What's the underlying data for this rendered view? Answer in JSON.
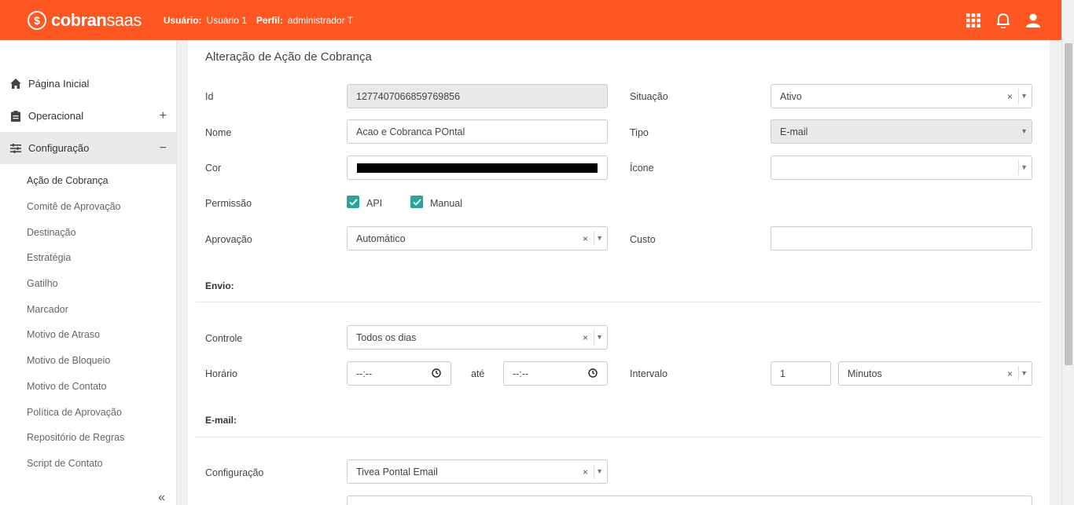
{
  "header": {
    "logo_symbol": "$",
    "logo_bold": "cobran",
    "logo_light": "saas",
    "user_label": "Usuário:",
    "user_value": "Usuário 1",
    "profile_label": "Perfil:",
    "profile_value": "administrador T",
    "accent_color": "#ff5722"
  },
  "sidebar": {
    "items": [
      {
        "label": "Página Inicial",
        "icon": "home-icon"
      },
      {
        "label": "Operacional",
        "icon": "clipboard-icon",
        "toggle": "+"
      },
      {
        "label": "Configuração",
        "icon": "sliders-icon",
        "toggle": "−"
      }
    ],
    "subitems": [
      "Ação de Cobrança",
      "Comitê de Aprovação",
      "Destinação",
      "Estratégia",
      "Gatilho",
      "Marcador",
      "Motivo de Atraso",
      "Motivo de Bloqueio",
      "Motivo de Contato",
      "Política de Aprovação",
      "Repositório de Regras",
      "Script de Contato"
    ],
    "collapse_label": "«"
  },
  "form": {
    "title": "Alteração de Ação de Cobrança",
    "id_label": "Id",
    "id_value": "1277407066859769856",
    "situacao_label": "Situação",
    "situacao_value": "Ativo",
    "nome_label": "Nome",
    "nome_value": "Acao e Cobranca POntal",
    "tipo_label": "Tipo",
    "tipo_value": "E-mail",
    "cor_label": "Cor",
    "cor_value": "#000000",
    "icone_label": "Ícone",
    "icone_value": "",
    "permissao_label": "Permissão",
    "perm_api_label": "API",
    "perm_manual_label": "Manual",
    "aprovacao_label": "Aprovação",
    "aprovacao_value": "Automático",
    "custo_label": "Custo",
    "custo_value": "",
    "envio_title": "Envio:",
    "controle_label": "Controle",
    "controle_value": "Todos os dias",
    "horario_label": "Horário",
    "horario_from": "--:--",
    "ate_label": "até",
    "horario_to": "--:--",
    "intervalo_label": "Intervalo",
    "intervalo_value": "1",
    "intervalo_unit": "Minutos",
    "email_title": "E-mail:",
    "config_label": "Configuração",
    "config_value": "Tivea Pontal Email",
    "clear_symbol": "×",
    "arrow_symbol": "▼"
  }
}
